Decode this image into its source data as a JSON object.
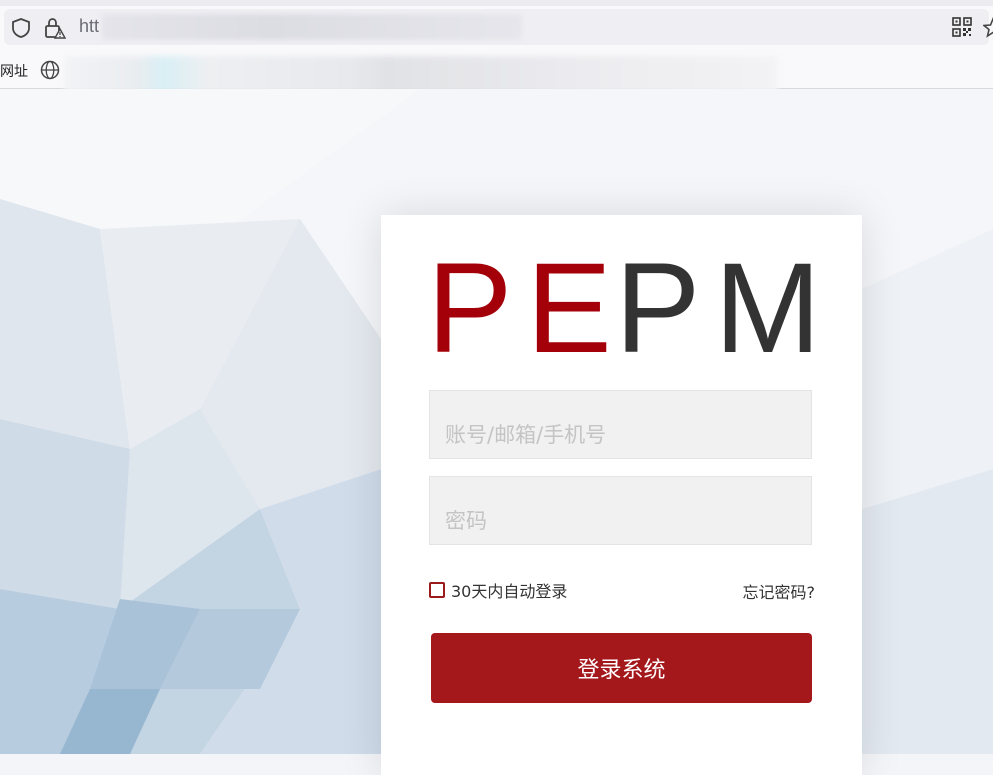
{
  "browser": {
    "url_visible": "htt",
    "bookmarks_label": "网址",
    "icons": [
      "shield-icon",
      "lock-warning-icon",
      "qr-code-icon",
      "star-icon",
      "globe-icon"
    ]
  },
  "login": {
    "logo": {
      "part1": "PE",
      "part2": "PM",
      "color1": "#a4000a",
      "color2": "#333333"
    },
    "account_placeholder": "账号/邮箱/手机号",
    "password_placeholder": "密码",
    "remember_label": "30天内自动登录",
    "remember_checked": false,
    "forgot_label": "忘记密码?",
    "submit_label": "登录系统",
    "accent_color": "#a4181c"
  }
}
